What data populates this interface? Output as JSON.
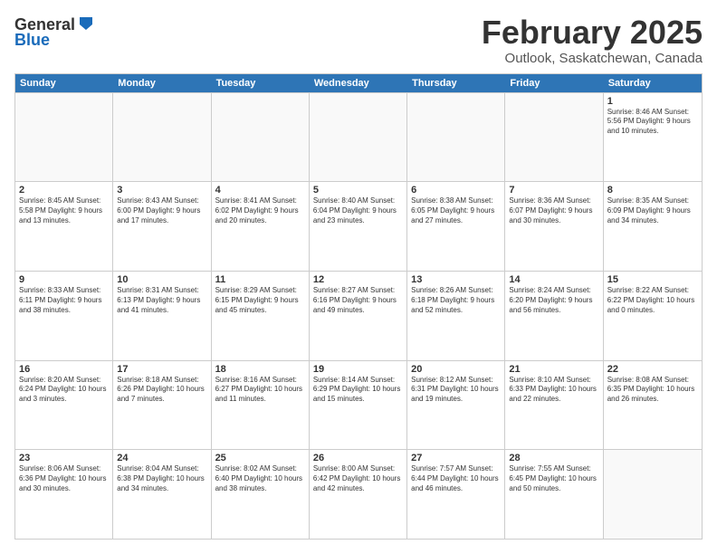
{
  "logo": {
    "general": "General",
    "blue": "Blue"
  },
  "title": "February 2025",
  "location": "Outlook, Saskatchewan, Canada",
  "days": [
    "Sunday",
    "Monday",
    "Tuesday",
    "Wednesday",
    "Thursday",
    "Friday",
    "Saturday"
  ],
  "weeks": [
    [
      {
        "date": "",
        "info": ""
      },
      {
        "date": "",
        "info": ""
      },
      {
        "date": "",
        "info": ""
      },
      {
        "date": "",
        "info": ""
      },
      {
        "date": "",
        "info": ""
      },
      {
        "date": "",
        "info": ""
      },
      {
        "date": "1",
        "info": "Sunrise: 8:46 AM\nSunset: 5:56 PM\nDaylight: 9 hours\nand 10 minutes."
      }
    ],
    [
      {
        "date": "2",
        "info": "Sunrise: 8:45 AM\nSunset: 5:58 PM\nDaylight: 9 hours\nand 13 minutes."
      },
      {
        "date": "3",
        "info": "Sunrise: 8:43 AM\nSunset: 6:00 PM\nDaylight: 9 hours\nand 17 minutes."
      },
      {
        "date": "4",
        "info": "Sunrise: 8:41 AM\nSunset: 6:02 PM\nDaylight: 9 hours\nand 20 minutes."
      },
      {
        "date": "5",
        "info": "Sunrise: 8:40 AM\nSunset: 6:04 PM\nDaylight: 9 hours\nand 23 minutes."
      },
      {
        "date": "6",
        "info": "Sunrise: 8:38 AM\nSunset: 6:05 PM\nDaylight: 9 hours\nand 27 minutes."
      },
      {
        "date": "7",
        "info": "Sunrise: 8:36 AM\nSunset: 6:07 PM\nDaylight: 9 hours\nand 30 minutes."
      },
      {
        "date": "8",
        "info": "Sunrise: 8:35 AM\nSunset: 6:09 PM\nDaylight: 9 hours\nand 34 minutes."
      }
    ],
    [
      {
        "date": "9",
        "info": "Sunrise: 8:33 AM\nSunset: 6:11 PM\nDaylight: 9 hours\nand 38 minutes."
      },
      {
        "date": "10",
        "info": "Sunrise: 8:31 AM\nSunset: 6:13 PM\nDaylight: 9 hours\nand 41 minutes."
      },
      {
        "date": "11",
        "info": "Sunrise: 8:29 AM\nSunset: 6:15 PM\nDaylight: 9 hours\nand 45 minutes."
      },
      {
        "date": "12",
        "info": "Sunrise: 8:27 AM\nSunset: 6:16 PM\nDaylight: 9 hours\nand 49 minutes."
      },
      {
        "date": "13",
        "info": "Sunrise: 8:26 AM\nSunset: 6:18 PM\nDaylight: 9 hours\nand 52 minutes."
      },
      {
        "date": "14",
        "info": "Sunrise: 8:24 AM\nSunset: 6:20 PM\nDaylight: 9 hours\nand 56 minutes."
      },
      {
        "date": "15",
        "info": "Sunrise: 8:22 AM\nSunset: 6:22 PM\nDaylight: 10 hours\nand 0 minutes."
      }
    ],
    [
      {
        "date": "16",
        "info": "Sunrise: 8:20 AM\nSunset: 6:24 PM\nDaylight: 10 hours\nand 3 minutes."
      },
      {
        "date": "17",
        "info": "Sunrise: 8:18 AM\nSunset: 6:26 PM\nDaylight: 10 hours\nand 7 minutes."
      },
      {
        "date": "18",
        "info": "Sunrise: 8:16 AM\nSunset: 6:27 PM\nDaylight: 10 hours\nand 11 minutes."
      },
      {
        "date": "19",
        "info": "Sunrise: 8:14 AM\nSunset: 6:29 PM\nDaylight: 10 hours\nand 15 minutes."
      },
      {
        "date": "20",
        "info": "Sunrise: 8:12 AM\nSunset: 6:31 PM\nDaylight: 10 hours\nand 19 minutes."
      },
      {
        "date": "21",
        "info": "Sunrise: 8:10 AM\nSunset: 6:33 PM\nDaylight: 10 hours\nand 22 minutes."
      },
      {
        "date": "22",
        "info": "Sunrise: 8:08 AM\nSunset: 6:35 PM\nDaylight: 10 hours\nand 26 minutes."
      }
    ],
    [
      {
        "date": "23",
        "info": "Sunrise: 8:06 AM\nSunset: 6:36 PM\nDaylight: 10 hours\nand 30 minutes."
      },
      {
        "date": "24",
        "info": "Sunrise: 8:04 AM\nSunset: 6:38 PM\nDaylight: 10 hours\nand 34 minutes."
      },
      {
        "date": "25",
        "info": "Sunrise: 8:02 AM\nSunset: 6:40 PM\nDaylight: 10 hours\nand 38 minutes."
      },
      {
        "date": "26",
        "info": "Sunrise: 8:00 AM\nSunset: 6:42 PM\nDaylight: 10 hours\nand 42 minutes."
      },
      {
        "date": "27",
        "info": "Sunrise: 7:57 AM\nSunset: 6:44 PM\nDaylight: 10 hours\nand 46 minutes."
      },
      {
        "date": "28",
        "info": "Sunrise: 7:55 AM\nSunset: 6:45 PM\nDaylight: 10 hours\nand 50 minutes."
      },
      {
        "date": "",
        "info": ""
      }
    ]
  ]
}
